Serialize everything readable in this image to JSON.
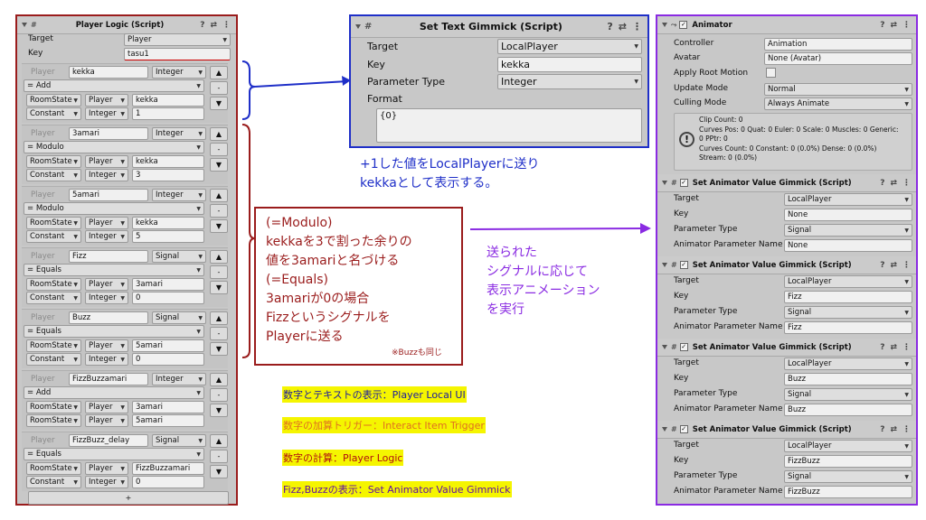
{
  "player_logic": {
    "title": "Player Logic (Script)",
    "target_label": "Target",
    "target_value": "Player",
    "key_label": "Key",
    "key_value": "tasu1",
    "add_button": "+",
    "blocks": [
      {
        "head": {
          "type": "Player",
          "name": "kekka",
          "value_type": "Integer"
        },
        "op": "= Add",
        "a": {
          "scope": "RoomState",
          "kind": "Player",
          "value": "kekka"
        },
        "b": {
          "scope": "Constant",
          "kind": "Integer",
          "value": "1"
        }
      },
      {
        "head": {
          "type": "Player",
          "name": "3amari",
          "value_type": "Integer"
        },
        "op": "= Modulo",
        "a": {
          "scope": "RoomState",
          "kind": "Player",
          "value": "kekka"
        },
        "b": {
          "scope": "Constant",
          "kind": "Integer",
          "value": "3"
        }
      },
      {
        "head": {
          "type": "Player",
          "name": "5amari",
          "value_type": "Integer"
        },
        "op": "= Modulo",
        "a": {
          "scope": "RoomState",
          "kind": "Player",
          "value": "kekka"
        },
        "b": {
          "scope": "Constant",
          "kind": "Integer",
          "value": "5"
        }
      },
      {
        "head": {
          "type": "Player",
          "name": "Fizz",
          "value_type": "Signal"
        },
        "op": "= Equals",
        "a": {
          "scope": "RoomState",
          "kind": "Player",
          "value": "3amari"
        },
        "b": {
          "scope": "Constant",
          "kind": "Integer",
          "value": "0"
        }
      },
      {
        "head": {
          "type": "Player",
          "name": "Buzz",
          "value_type": "Signal"
        },
        "op": "= Equals",
        "a": {
          "scope": "RoomState",
          "kind": "Player",
          "value": "5amari"
        },
        "b": {
          "scope": "Constant",
          "kind": "Integer",
          "value": "0"
        }
      },
      {
        "head": {
          "type": "Player",
          "name": "FizzBuzzamari",
          "value_type": "Integer"
        },
        "op": "= Add",
        "a": {
          "scope": "RoomState",
          "kind": "Player",
          "value": "3amari"
        },
        "b": {
          "scope": "RoomState",
          "kind": "Player",
          "value": "5amari"
        }
      },
      {
        "head": {
          "type": "Player",
          "name": "FizzBuzz_delay",
          "value_type": "Signal"
        },
        "op": "= Equals",
        "a": {
          "scope": "RoomState",
          "kind": "Player",
          "value": "FizzBuzzamari"
        },
        "b": {
          "scope": "Constant",
          "kind": "Integer",
          "value": "0"
        }
      }
    ]
  },
  "set_text": {
    "title": "Set Text Gimmick (Script)",
    "target_label": "Target",
    "target_value": "LocalPlayer",
    "key_label": "Key",
    "key_value": "kekka",
    "param_label": "Parameter Type",
    "param_value": "Integer",
    "format_label": "Format",
    "format_value": "{0}"
  },
  "animator": {
    "title": "Animator",
    "controller_label": "Controller",
    "controller_value": "Animation",
    "avatar_label": "Avatar",
    "avatar_value": "None (Avatar)",
    "root_motion_label": "Apply Root Motion",
    "update_label": "Update Mode",
    "update_value": "Normal",
    "culling_label": "Culling Mode",
    "culling_value": "Always Animate",
    "info_lines": [
      "Clip Count: 0",
      "Curves Pos: 0 Quat: 0 Euler: 0 Scale: 0 Muscles: 0 Generic:",
      "0 PPtr: 0",
      "Curves Count: 0 Constant: 0 (0.0%) Dense: 0 (0.0%)",
      "Stream: 0 (0.0%)"
    ]
  },
  "sav_gimmicks": [
    {
      "title": "Set Animator Value Gimmick (Script)",
      "target": "LocalPlayer",
      "key": "None",
      "param": "Signal",
      "anim_param": "None"
    },
    {
      "title": "Set Animator Value Gimmick (Script)",
      "target": "LocalPlayer",
      "key": "Fizz",
      "param": "Signal",
      "anim_param": "Fizz"
    },
    {
      "title": "Set Animator Value Gimmick (Script)",
      "target": "LocalPlayer",
      "key": "Buzz",
      "param": "Signal",
      "anim_param": "Buzz"
    },
    {
      "title": "Set Animator Value Gimmick (Script)",
      "target": "LocalPlayer",
      "key": "FizzBuzz",
      "param": "Signal",
      "anim_param": "FizzBuzz"
    }
  ],
  "sav_labels": {
    "target": "Target",
    "key": "Key",
    "param": "Parameter Type",
    "anim_param": "Animator Parameter Name"
  },
  "annotations": {
    "blue_note": [
      "+1した値をLocalPlayerに送り",
      "kekkaとして表示する。"
    ],
    "red_note": [
      "(=Modulo)",
      "kekkaを3で割った余りの",
      "値を3amariと名づける",
      "(=Equals)",
      "3amariが0の場合",
      "Fizzというシグナルを",
      "Playerに送る"
    ],
    "red_small": "※Buzzも同じ",
    "purple_note": [
      "送られた",
      "シグナルに応じて",
      "表示アニメーション",
      "を実行"
    ]
  },
  "legend": [
    {
      "text": "数字とテキストの表示：Player Local UI",
      "bg": "#f5f500",
      "fg": "#1a1aa0"
    },
    {
      "text": "数字の加算トリガー：Interact Item Trigger",
      "bg": "#f5f500",
      "fg": "#e07020"
    },
    {
      "text": "数字の計算：Player Logic",
      "bg": "#f5f500",
      "fg": "#b01010"
    },
    {
      "text": "Fizz,Buzzの表示：Set Animator Value Gimmick",
      "bg": "#f5f500",
      "fg": "#6010a0"
    }
  ],
  "colors": {
    "red_frame": "#9a1c1c",
    "blue_frame": "#1f2fc8",
    "purple_frame": "#8a2be2"
  }
}
